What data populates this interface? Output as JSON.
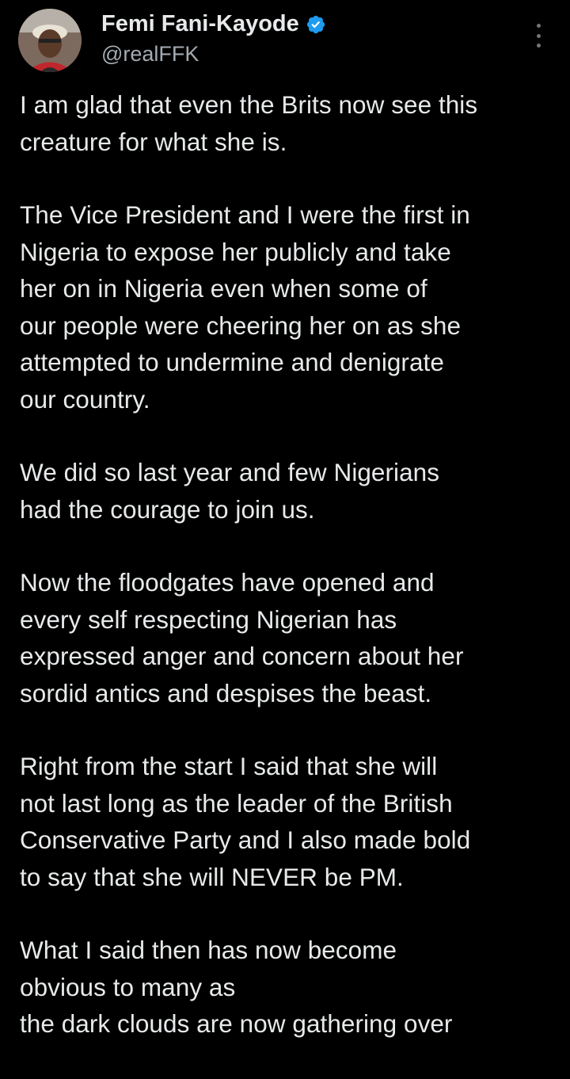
{
  "author": {
    "display_name": "Femi Fani-Kayode",
    "handle": "@realFFK",
    "avatar_icon": "profile-photo",
    "verified_icon": "verified-badge-icon",
    "verified_color": "#1d9bf0"
  },
  "header": {
    "more_icon": "more-options-icon"
  },
  "tweet": {
    "paragraphs": [
      [
        "I am glad that even the Brits now see this",
        "creature for what she is."
      ],
      [
        "The Vice President and I were the first in",
        "Nigeria to expose her publicly and take",
        "her on in Nigeria even when some of",
        "our people were cheering her on as she",
        "attempted to undermine and denigrate",
        "our country."
      ],
      [
        "We did so last year and few Nigerians",
        "had the courage to join us."
      ],
      [
        "Now the floodgates have opened and",
        "every self respecting Nigerian has",
        "expressed anger and concern about her",
        "sordid antics and despises the beast."
      ],
      [
        "Right from the start I said that she will",
        "not last long as the leader of the British",
        "Conservative Party and I also made bold",
        "to say that she will NEVER be PM."
      ],
      [
        "What I said then has now become",
        "obvious to many as",
        "the dark clouds are now gathering over"
      ]
    ]
  },
  "colors": {
    "background": "#000000",
    "text": "#e7e9ea",
    "secondary_text": "#a3aab0",
    "accent": "#1d9bf0"
  }
}
